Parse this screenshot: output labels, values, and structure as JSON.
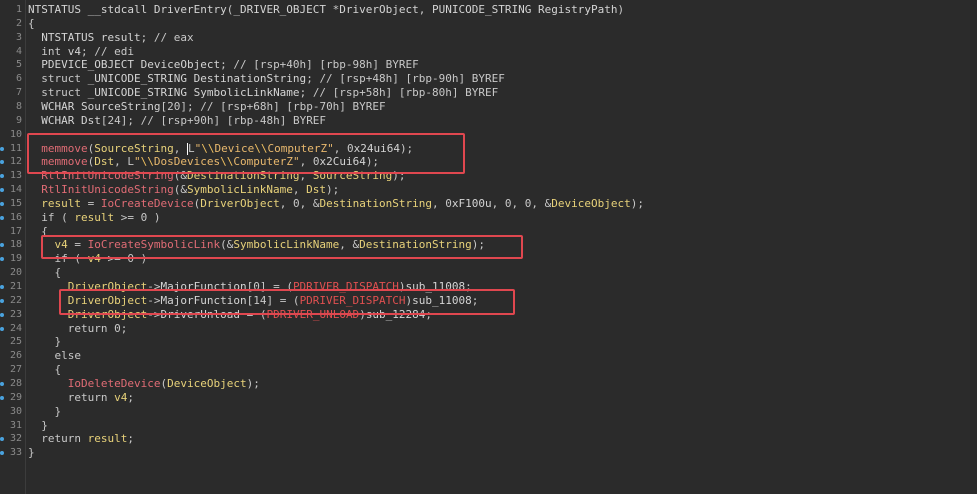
{
  "editor": {
    "lines": [
      {
        "n": "1",
        "text": "NTSTATUS __stdcall DriverEntry(_DRIVER_OBJECT *DriverObject, PUNICODE_STRING RegistryPath)"
      },
      {
        "n": "2",
        "text": "{"
      },
      {
        "n": "3",
        "text": "  NTSTATUS result; // eax"
      },
      {
        "n": "4",
        "text": "  int v4; // edi"
      },
      {
        "n": "5",
        "text": "  PDEVICE_OBJECT DeviceObject; // [rsp+40h] [rbp-98h] BYREF"
      },
      {
        "n": "6",
        "text": "  struct _UNICODE_STRING DestinationString; // [rsp+48h] [rbp-90h] BYREF"
      },
      {
        "n": "7",
        "text": "  struct _UNICODE_STRING SymbolicLinkName; // [rsp+58h] [rbp-80h] BYREF"
      },
      {
        "n": "8",
        "text": "  WCHAR SourceString[20]; // [rsp+68h] [rbp-70h] BYREF"
      },
      {
        "n": "9",
        "text": "  WCHAR Dst[24]; // [rsp+90h] [rbp-48h] BYREF"
      },
      {
        "n": "10",
        "text": ""
      },
      {
        "n": "11",
        "text": "  memmove(SourceString, L\"\\\\Device\\\\ComputerZ\", 0x24ui64);"
      },
      {
        "n": "12",
        "text": "  memmove(Dst, L\"\\\\DosDevices\\\\ComputerZ\", 0x2Cui64);"
      },
      {
        "n": "13",
        "text": "  RtlInitUnicodeString(&DestinationString, SourceString);"
      },
      {
        "n": "14",
        "text": "  RtlInitUnicodeString(&SymbolicLinkName, Dst);"
      },
      {
        "n": "15",
        "text": "  result = IoCreateDevice(DriverObject, 0, &DestinationString, 0xF100u, 0, 0, &DeviceObject);"
      },
      {
        "n": "16",
        "text": "  if ( result >= 0 )"
      },
      {
        "n": "17",
        "text": "  {"
      },
      {
        "n": "18",
        "text": "    v4 = IoCreateSymbolicLink(&SymbolicLinkName, &DestinationString);"
      },
      {
        "n": "19",
        "text": "    if ( v4 >= 0 )"
      },
      {
        "n": "20",
        "text": "    {"
      },
      {
        "n": "21",
        "text": "      DriverObject->MajorFunction[0] = (PDRIVER_DISPATCH)sub_11008;"
      },
      {
        "n": "22",
        "text": "      DriverObject->MajorFunction[14] = (PDRIVER_DISPATCH)sub_11008;"
      },
      {
        "n": "23",
        "text": "      DriverObject->DriverUnload = (PDRIVER_UNLOAD)sub_12284;"
      },
      {
        "n": "24",
        "text": "      return 0;"
      },
      {
        "n": "25",
        "text": "    }"
      },
      {
        "n": "26",
        "text": "    else"
      },
      {
        "n": "27",
        "text": "    {"
      },
      {
        "n": "28",
        "text": "      IoDeleteDevice(DeviceObject);"
      },
      {
        "n": "29",
        "text": "      return v4;"
      },
      {
        "n": "30",
        "text": "    }"
      },
      {
        "n": "31",
        "text": "  }"
      },
      {
        "n": "32",
        "text": "  return result;"
      },
      {
        "n": "33",
        "text": "}"
      }
    ],
    "breakpoint_lines": [
      "11",
      "12",
      "13",
      "14",
      "15",
      "16",
      "18",
      "19",
      "21",
      "22",
      "23",
      "24",
      "28",
      "29",
      "32",
      "33"
    ],
    "highlight_color": "#e0474f"
  }
}
